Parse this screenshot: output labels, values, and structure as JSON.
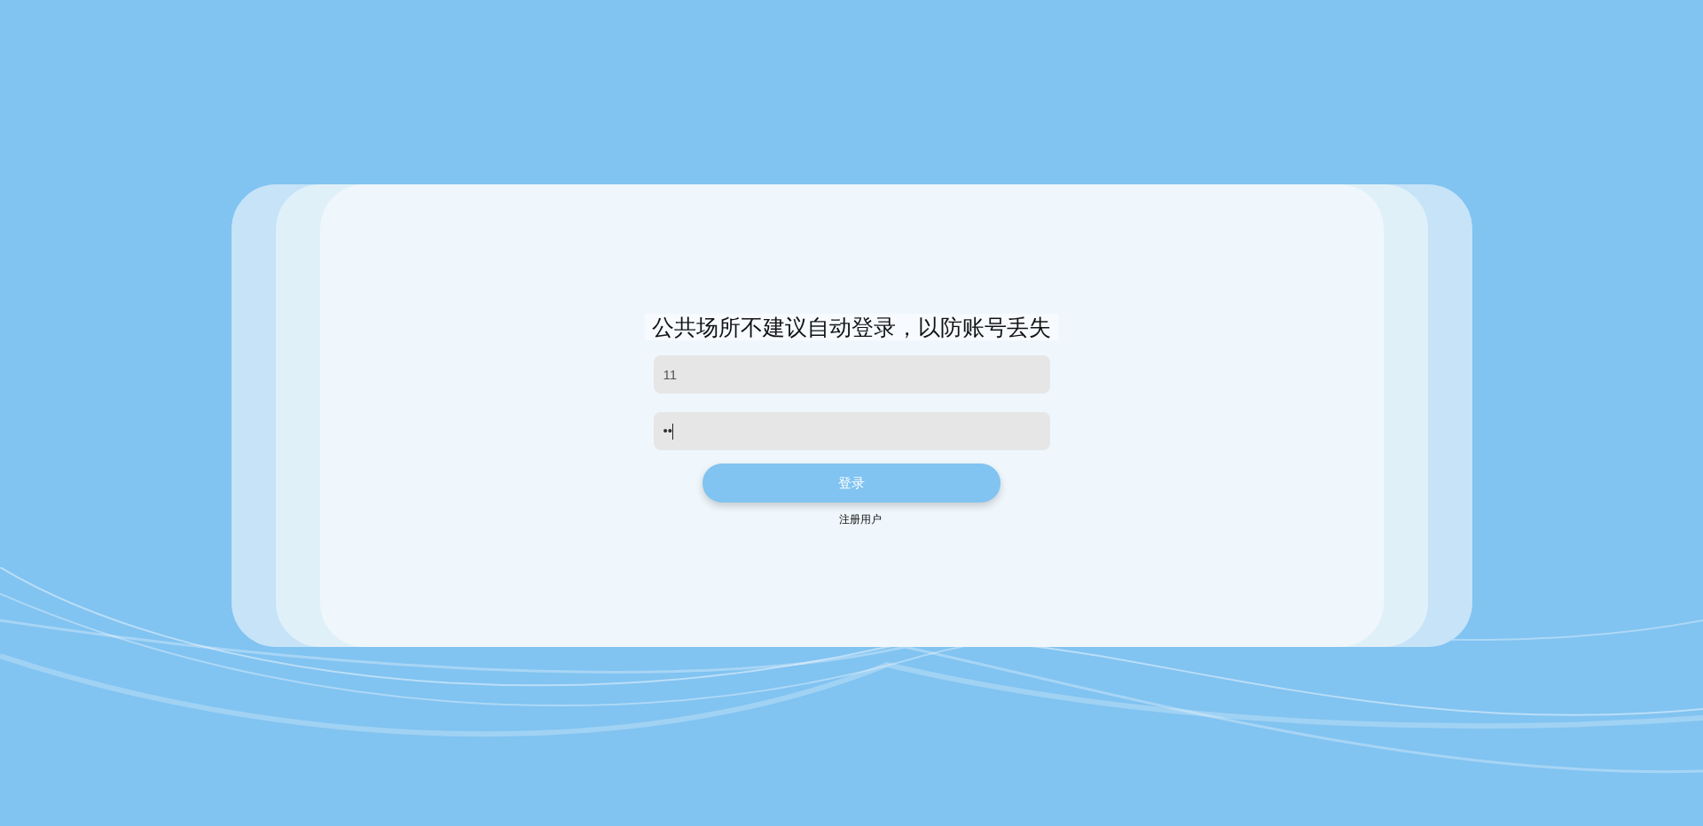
{
  "login": {
    "notice": "公共场所不建议自动登录，以防账号丢失",
    "username": {
      "value": "11"
    },
    "password": {
      "value": "••"
    },
    "submit": "登录",
    "register_link": "注册用户"
  }
}
